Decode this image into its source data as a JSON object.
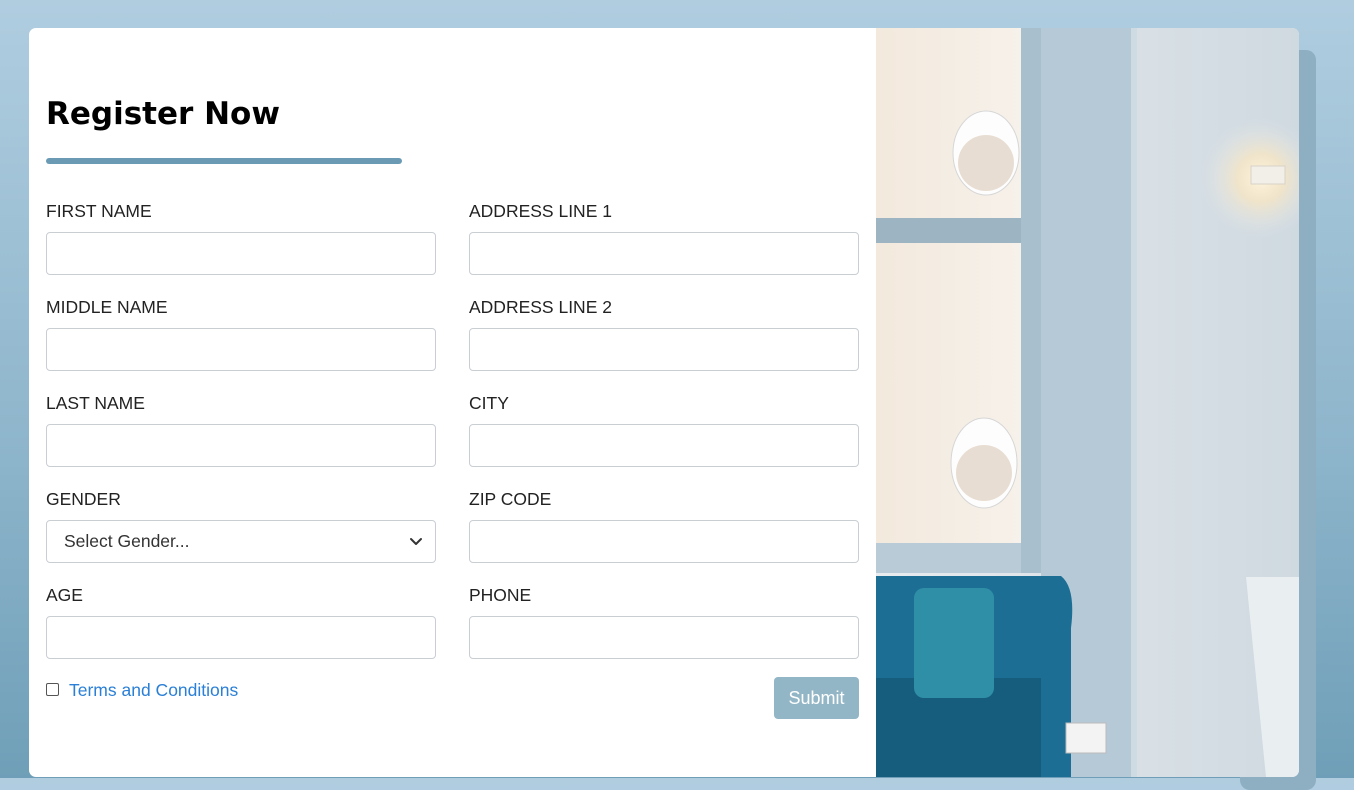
{
  "form": {
    "title": "Register Now",
    "fields_left": [
      {
        "label": "FIRST NAME",
        "value": ""
      },
      {
        "label": "MIDDLE NAME",
        "value": ""
      },
      {
        "label": "LAST NAME",
        "value": ""
      },
      {
        "label": "GENDER",
        "selected": "Select Gender..."
      },
      {
        "label": "AGE",
        "value": ""
      }
    ],
    "fields_right": [
      {
        "label": "ADDRESS LINE 1",
        "value": ""
      },
      {
        "label": "ADDRESS LINE 2",
        "value": ""
      },
      {
        "label": "CITY",
        "value": ""
      },
      {
        "label": "ZIP CODE",
        "value": ""
      },
      {
        "label": "PHONE",
        "value": ""
      }
    ],
    "terms_label": "Terms and Conditions",
    "terms_checked": false,
    "submit_label": "Submit"
  },
  "colors": {
    "accent_bar": "#6b9bb4",
    "submit_bg": "#93b6c7",
    "link": "#2a7fd6"
  },
  "icons": {
    "select_chevron": "chevron-down-icon"
  }
}
